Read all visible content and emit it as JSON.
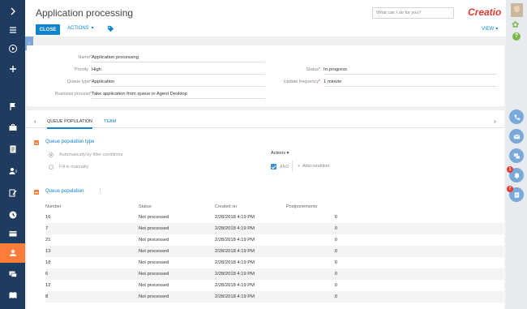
{
  "header": {
    "title": "Application processing",
    "close_label": "CLOSE",
    "actions_label": "ACTIONS",
    "search_placeholder": "What can I do for you?",
    "logo_text": "Creatio",
    "view_label": "VIEW"
  },
  "sidebar": {
    "items": [
      {
        "name": "expand-icon"
      },
      {
        "name": "menu-icon"
      },
      {
        "name": "play-icon"
      },
      {
        "name": "add-icon"
      },
      {
        "name": "flag-icon"
      },
      {
        "name": "briefcase-icon"
      },
      {
        "name": "document-icon"
      },
      {
        "name": "contact-icon"
      },
      {
        "name": "edit-icon"
      },
      {
        "name": "clock-icon"
      },
      {
        "name": "card-icon"
      },
      {
        "name": "queue-icon",
        "active": true
      },
      {
        "name": "chat-icon"
      },
      {
        "name": "book-icon"
      }
    ]
  },
  "rightbar": {
    "badges": [
      "1",
      "7"
    ]
  },
  "profile": {
    "name_label": "Name",
    "name_value": "Application processing",
    "priority_label": "Priority",
    "priority_value": "High",
    "queue_type_label": "Queue type",
    "queue_type_value": "Application",
    "business_process_label": "Business process",
    "business_process_value": "Take application from queue in Agent Desktop",
    "status_label": "Status",
    "status_value": "In progress",
    "update_frequency_label": "Update frequency",
    "update_frequency_value": "1 minute"
  },
  "tabs": [
    "QUEUE POPULATION",
    "TEAM"
  ],
  "population_type": {
    "title": "Queue population type",
    "option_filter": "Automatically by filter conditions",
    "option_manual": "Fill in manually",
    "actions_label": "Actions",
    "and_label": "AND",
    "add_condition_label": "Add condition"
  },
  "queue_population": {
    "title": "Queue population",
    "columns": [
      "Number",
      "Status",
      "Created on",
      "Postponements"
    ],
    "rows": [
      [
        "16",
        "Not processed",
        "2/28/2018 4:19 PM",
        "0"
      ],
      [
        "7",
        "Not processed",
        "2/28/2018 4:19 PM",
        "0"
      ],
      [
        "21",
        "Not processed",
        "2/28/2018 4:19 PM",
        "0"
      ],
      [
        "13",
        "Not processed",
        "2/28/2018 4:19 PM",
        "0"
      ],
      [
        "18",
        "Not processed",
        "2/28/2018 4:19 PM",
        "0"
      ],
      [
        "6",
        "Not processed",
        "2/28/2018 4:19 PM",
        "0"
      ],
      [
        "12",
        "Not processed",
        "2/28/2018 4:19 PM",
        "0"
      ],
      [
        "8",
        "Not processed",
        "2/28/2018 4:19 PM",
        "0"
      ]
    ]
  }
}
